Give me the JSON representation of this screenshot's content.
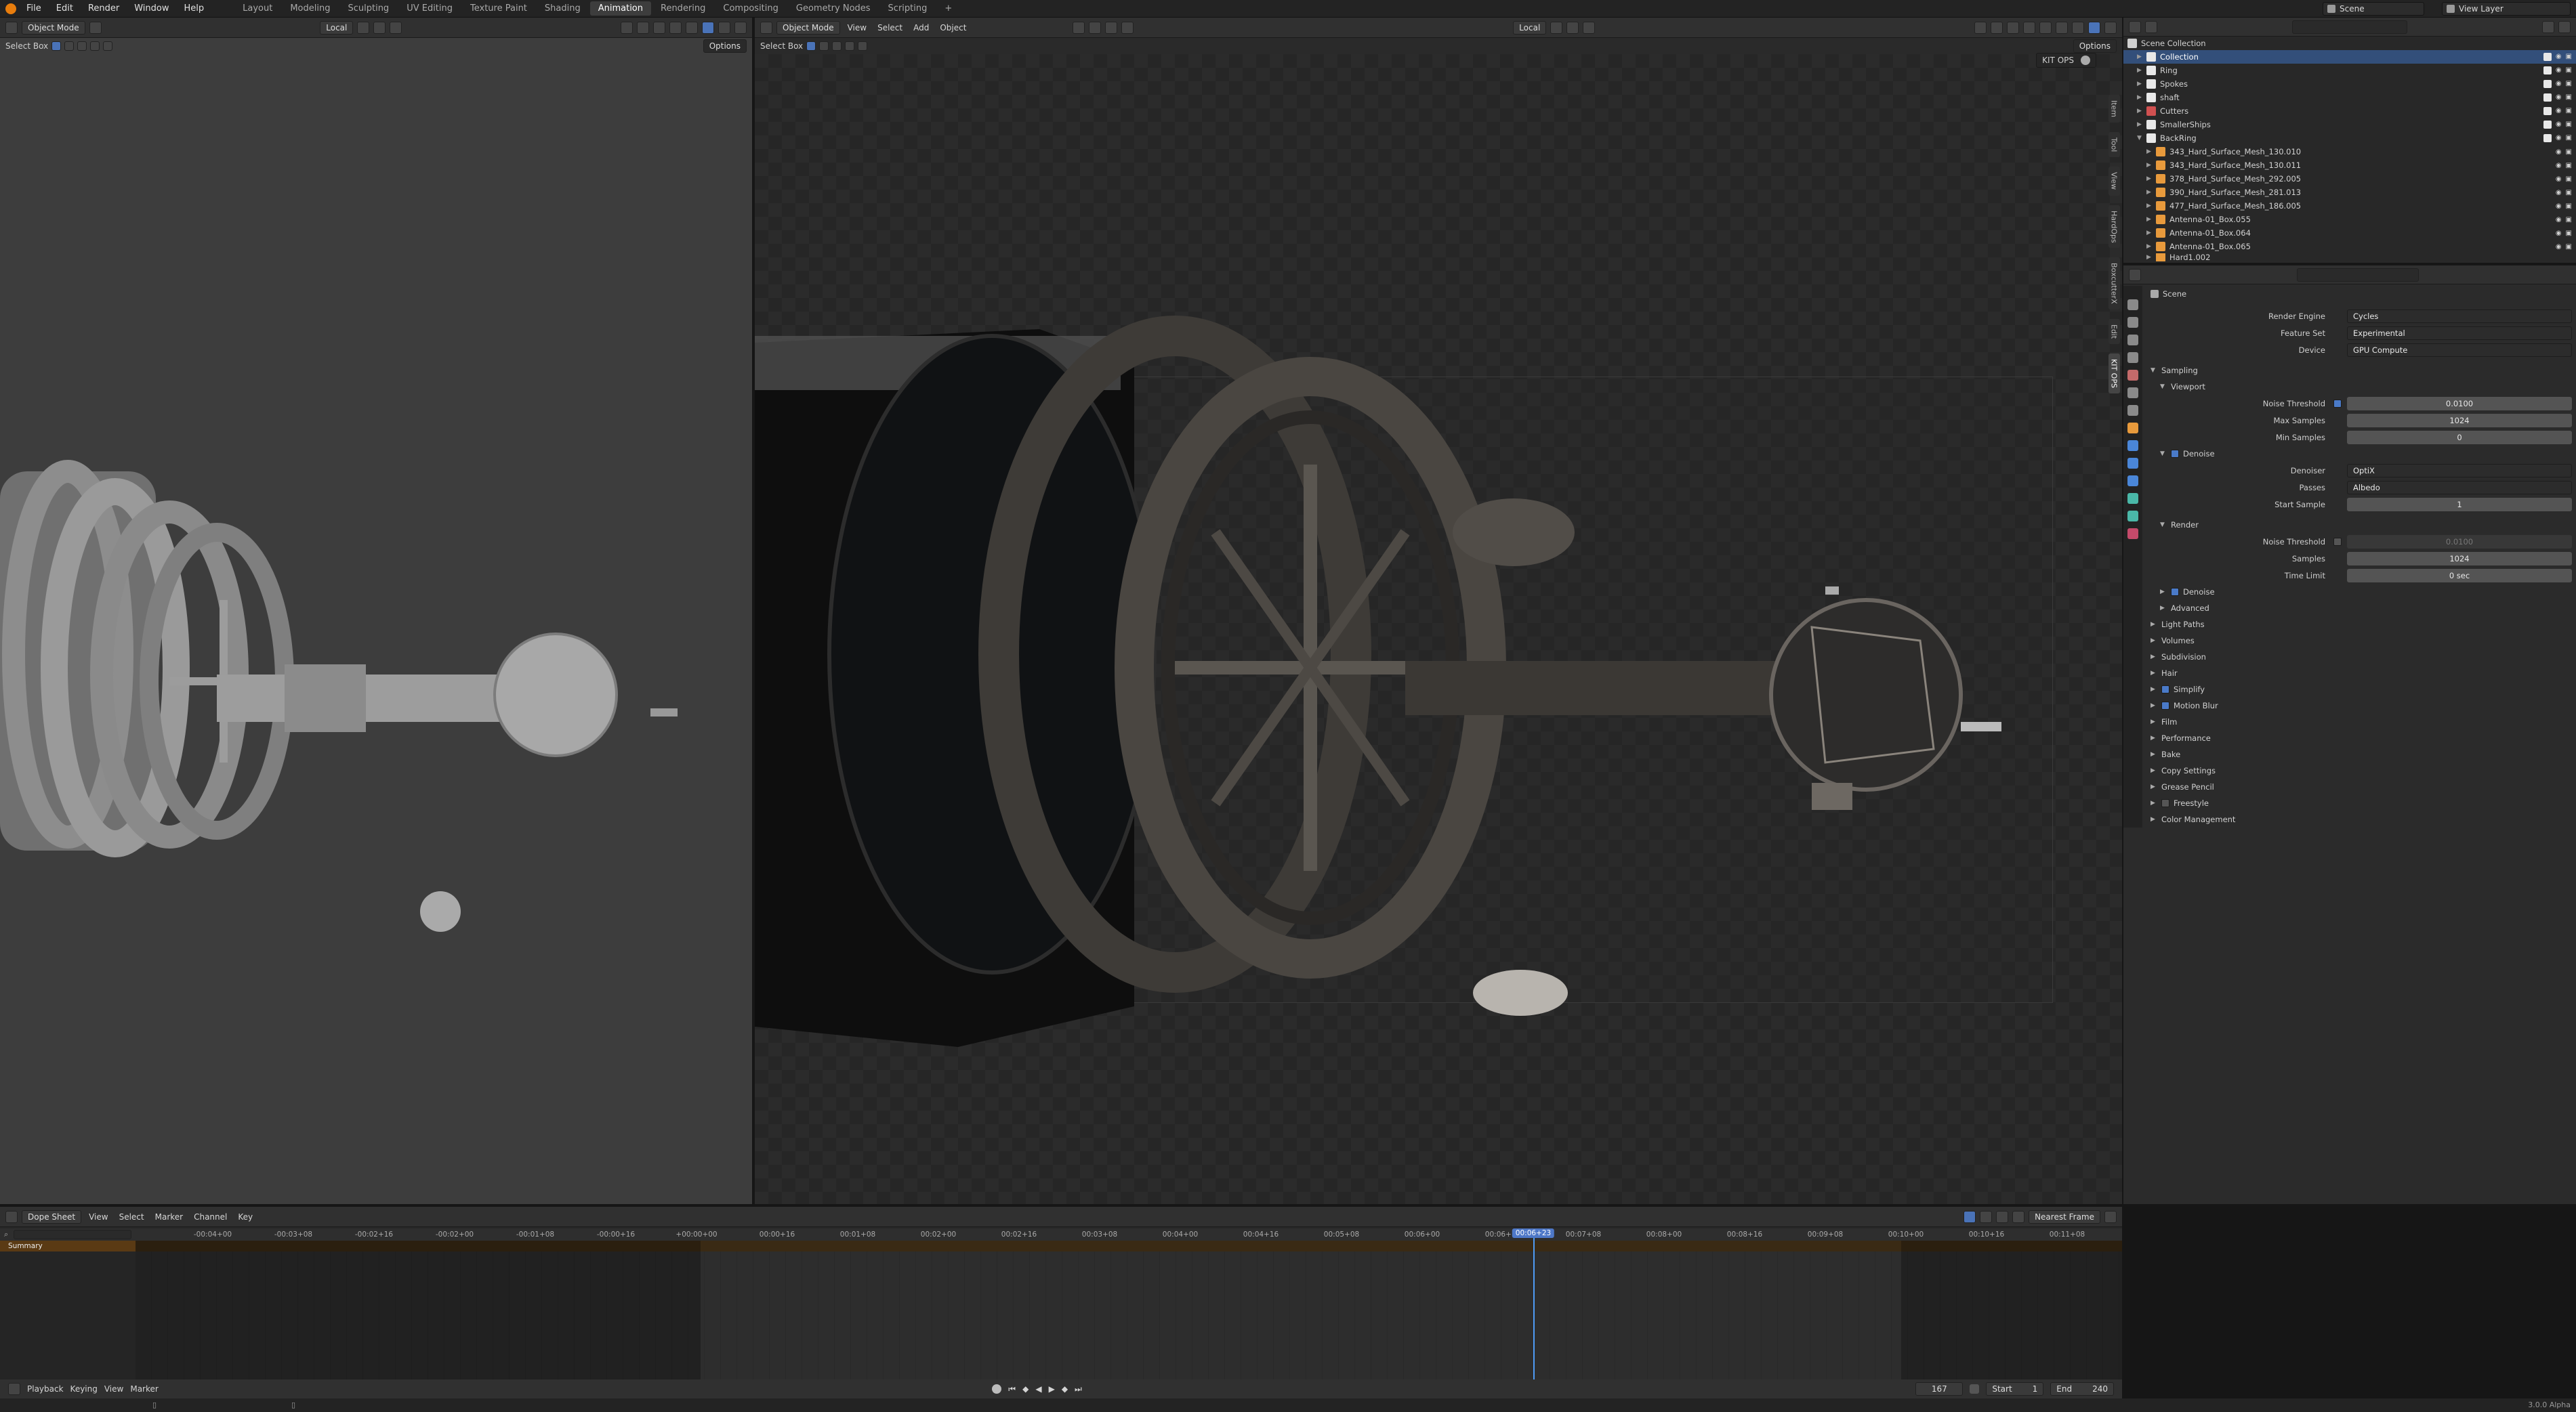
{
  "topbar": {
    "menu": [
      "File",
      "Edit",
      "Render",
      "Window",
      "Help"
    ],
    "workspaces": [
      "Layout",
      "Modeling",
      "Sculpting",
      "UV Editing",
      "Texture Paint",
      "Shading",
      "Animation",
      "Rendering",
      "Compositing",
      "Geometry Nodes",
      "Scripting"
    ],
    "active_workspace": "Animation",
    "add_tab": "+",
    "scene": "Scene",
    "view_layer": "View Layer"
  },
  "viewport_left": {
    "mode": "Object Mode",
    "orientation": "Local",
    "tool": "Select Box",
    "options": "Options"
  },
  "viewport_main": {
    "mode": "Object Mode",
    "menus": [
      "View",
      "Select",
      "Add",
      "Object"
    ],
    "orientation": "Local",
    "tool": "Select Box",
    "options": "Options",
    "kitops_panel": "KIT OPS",
    "side_tabs": [
      "Item",
      "Tool",
      "View",
      "HardOps",
      "BoxcutterX",
      "Edit",
      "KIT OPS"
    ]
  },
  "outliner": {
    "root": "Scene Collection",
    "items": [
      {
        "name": "Collection",
        "selected": true,
        "indent": 1
      },
      {
        "name": "Ring",
        "selected": false,
        "indent": 1
      },
      {
        "name": "Spokes",
        "selected": false,
        "indent": 1
      },
      {
        "name": "shaft",
        "selected": false,
        "indent": 1
      },
      {
        "name": "Cutters",
        "selected": false,
        "indent": 1
      },
      {
        "name": "SmallerShips",
        "selected": false,
        "indent": 1
      },
      {
        "name": "BackRing",
        "selected": false,
        "indent": 1
      },
      {
        "name": "343_Hard_Surface_Mesh_130.010",
        "selected": false,
        "indent": 2
      },
      {
        "name": "343_Hard_Surface_Mesh_130.011",
        "selected": false,
        "indent": 2
      },
      {
        "name": "378_Hard_Surface_Mesh_292.005",
        "selected": false,
        "indent": 2
      },
      {
        "name": "390_Hard_Surface_Mesh_281.013",
        "selected": false,
        "indent": 2
      },
      {
        "name": "477_Hard_Surface_Mesh_186.005",
        "selected": false,
        "indent": 2
      },
      {
        "name": "Antenna-01_Box.055",
        "selected": false,
        "indent": 2
      },
      {
        "name": "Antenna-01_Box.064",
        "selected": false,
        "indent": 2
      },
      {
        "name": "Antenna-01_Box.065",
        "selected": false,
        "indent": 2
      },
      {
        "name": "Hard1.002",
        "selected": false,
        "indent": 2
      }
    ]
  },
  "properties": {
    "context": "Scene",
    "render_engine_label": "Render Engine",
    "render_engine": "Cycles",
    "feature_set_label": "Feature Set",
    "feature_set": "Experimental",
    "device_label": "Device",
    "device": "GPU Compute",
    "sampling": "Sampling",
    "viewport": "Viewport",
    "noise_threshold_label": "Noise Threshold",
    "vp_noise_threshold": "0.0100",
    "max_samples_label": "Max Samples",
    "vp_max_samples": "1024",
    "min_samples_label": "Min Samples",
    "vp_min_samples": "0",
    "denoise": "Denoise",
    "denoiser_label": "Denoiser",
    "denoiser": "OptiX",
    "passes_label": "Passes",
    "passes": "Albedo",
    "start_sample_label": "Start Sample",
    "start_sample": "1",
    "render": "Render",
    "r_noise_threshold": "0.0100",
    "samples_label": "Samples",
    "r_samples": "1024",
    "time_limit_label": "Time Limit",
    "time_limit": "0 sec",
    "render_denoise": "Denoise",
    "advanced": "Advanced",
    "sections": [
      "Light Paths",
      "Volumes",
      "Subdivision",
      "Hair",
      "Simplify",
      "Motion Blur",
      "Film",
      "Performance",
      "Bake",
      "Copy Settings",
      "Grease Pencil",
      "Freestyle",
      "Color Management"
    ]
  },
  "dopesheet": {
    "editor": "Dope Sheet",
    "menus": [
      "View",
      "Select",
      "Marker",
      "Channel",
      "Key"
    ],
    "snap": "Nearest Frame",
    "summary": "Summary",
    "ruler_labels": [
      "-00:04+00",
      "-00:03+08",
      "-00:02+16",
      "-00:02+00",
      "-00:01+08",
      "-00:00+16",
      "+00:00+00",
      "00:00+16",
      "00:01+08",
      "00:02+00",
      "00:02+16",
      "00:03+08",
      "00:04+00",
      "00:04+16",
      "00:05+08",
      "00:06+00",
      "00:06+16",
      "00:07+08",
      "00:08+00",
      "00:08+16",
      "00:09+08",
      "00:10+00",
      "00:10+16",
      "00:11+08"
    ],
    "current_time": "00:06+23",
    "playback": "Playback",
    "keying": "Keying",
    "view": "View",
    "marker": "Marker",
    "frame": "167",
    "start_label": "Start",
    "start": "1",
    "end_label": "End",
    "end": "240"
  },
  "status": {
    "version": "3.0.0 Alpha"
  }
}
